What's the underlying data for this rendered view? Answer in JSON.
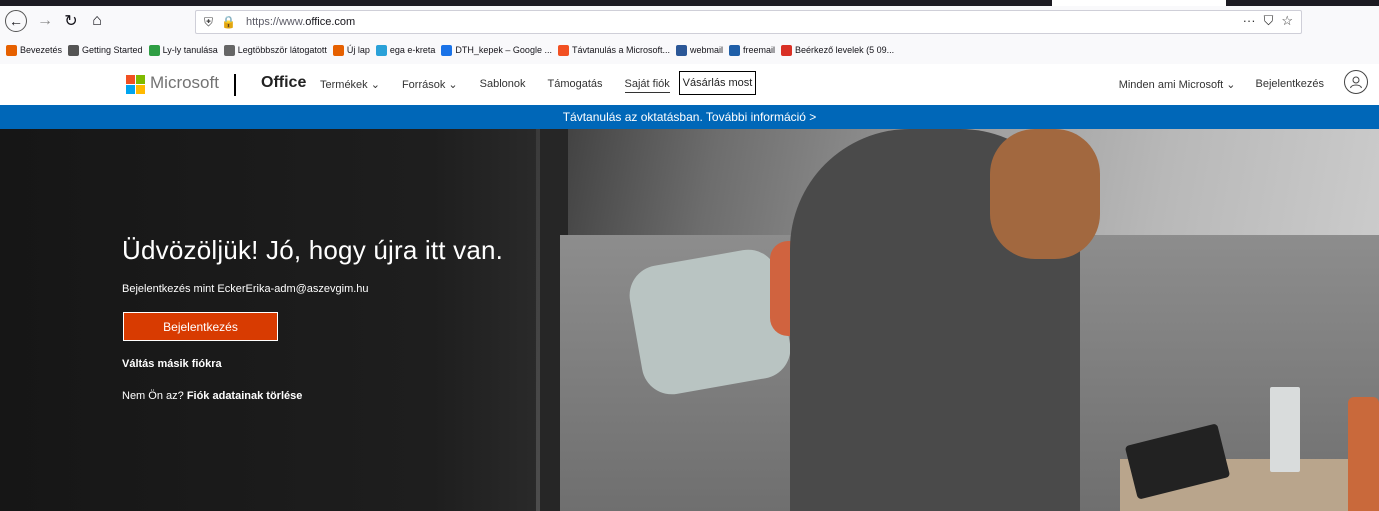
{
  "browser": {
    "url_prefix": "https://www.",
    "url_domain": "office.com",
    "back_glyph": "←",
    "forward_glyph": "→",
    "reload_glyph": "↻",
    "home_glyph": "⌂",
    "more_glyph": "···",
    "pocket_glyph": "⛉",
    "star_glyph": "☆"
  },
  "bookmarks": [
    {
      "label": "Bevezetés",
      "color": "#e66000"
    },
    {
      "label": "Getting Started",
      "color": "#555555"
    },
    {
      "label": "Ly-ly tanulása",
      "color": "#2f9e44"
    },
    {
      "label": "Legtöbbször látogatott",
      "color": "#666666"
    },
    {
      "label": "Új lap",
      "color": "#e66000"
    },
    {
      "label": "ega e-kreta",
      "color": "#2aa1d8"
    },
    {
      "label": "DTH_kepek – Google ...",
      "color": "#1a73e8"
    },
    {
      "label": "Távtanulás a Microsoft...",
      "color": "#f25022"
    },
    {
      "label": "webmail",
      "color": "#2b5797"
    },
    {
      "label": "freemail",
      "color": "#1f5fa8"
    },
    {
      "label": "Beérkező levelek (5 09...",
      "color": "#d93025"
    }
  ],
  "msnav": {
    "brand": "Microsoft",
    "product": "Office",
    "links": [
      "Termékek ⌄",
      "Források ⌄",
      "Sablonok",
      "Támogatás",
      "Saját fiók"
    ],
    "buy_button": "Vásárlás most",
    "all_microsoft": "Minden ami Microsoft ⌄",
    "sign_in": "Bejelentkezés",
    "logo_colors": [
      "#f25022",
      "#7fba00",
      "#00a4ef",
      "#ffb900"
    ]
  },
  "banner": {
    "text": "Távtanulás az oktatásban. További információ >"
  },
  "hero": {
    "heading": "Üdvözöljük! Jó, hogy újra itt van.",
    "signed_in_as": "Bejelentkezés mint EckerErika-adm@aszevgim.hu",
    "signin_button": "Bejelentkezés",
    "switch_account": "Váltás másik fiókra",
    "not_you": "Nem Ön az?",
    "forget_account": "Fiók adatainak törlése"
  }
}
